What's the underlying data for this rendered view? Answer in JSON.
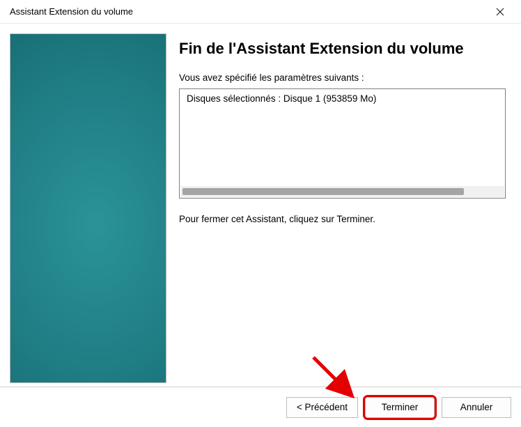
{
  "window": {
    "title": "Assistant Extension du volume"
  },
  "content": {
    "heading": "Fin de l'Assistant Extension du volume",
    "intro": "Vous avez spécifié les paramètres suivants :",
    "summary": "Disques sélectionnés : Disque 1 (953859 Mo)",
    "closing": "Pour fermer cet Assistant, cliquez sur Terminer."
  },
  "buttons": {
    "back": "< Précédent",
    "finish": "Terminer",
    "cancel": "Annuler"
  }
}
